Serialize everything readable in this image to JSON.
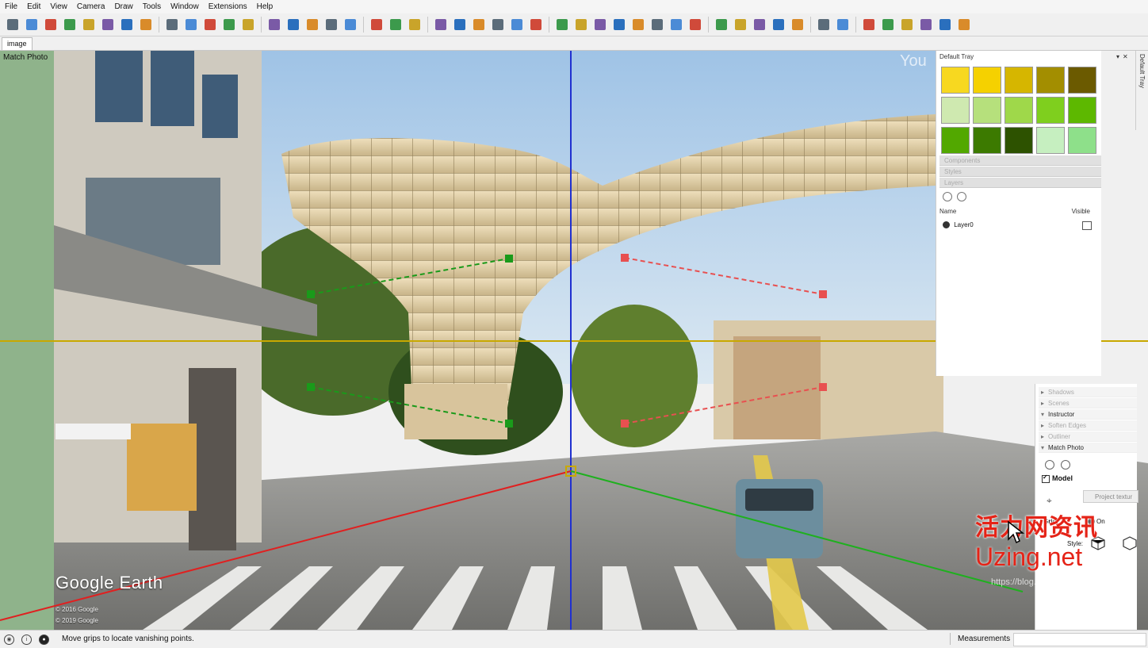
{
  "menu": [
    "File",
    "Edit",
    "View",
    "Camera",
    "Draw",
    "Tools",
    "Window",
    "Extensions",
    "Help"
  ],
  "toolbar_icons": [
    "select-orbit-icon",
    "zoom-icon",
    "paint-icon",
    "eraser-icon",
    "shaded-icon",
    "measure-tape-icon",
    "help-icon",
    "line-icon",
    "component-icon",
    "group-icon",
    "solid-union-icon",
    "solid-sub-icon",
    "arrow-select-icon",
    "section-plane-icon",
    "section-display-icon",
    "align-left-icon",
    "align-center-icon",
    "align-right-icon",
    "minus-icon",
    "plus-icon",
    "equal-icon",
    "grid-1-icon",
    "grid-2-icon",
    "grid-3-icon",
    "grid-4-icon",
    "grid-5-icon",
    "grid-6-icon",
    "texture-icon",
    "material-icon",
    "camera-icon",
    "checker-icon",
    "scatter-icon",
    "link-icon",
    "window-icon",
    "window-2-icon",
    "dim-icon",
    "dim-x-icon",
    "panel-icon",
    "pencil-icon",
    "delete-icon",
    "blue-tag-icon",
    "blue-diamond-icon",
    "yellow-diamond-icon",
    "green-diamond-icon",
    "red-diamond-icon",
    "stack-icon",
    "flag-icon",
    "warning-icon"
  ],
  "tab": {
    "label": "image"
  },
  "scene": {
    "label": "Match Photo",
    "google_earth": "Google Earth",
    "copyright1": "© 2016 Google",
    "copyright2": "© 2019 Google",
    "you_text": "You",
    "axis_colors": {
      "red": "#e02020",
      "green": "#1fb01f",
      "blue": "#2030d0",
      "horizon": "#c8a800"
    }
  },
  "tray": {
    "title": "Default Tray",
    "side_label": "Default Tray",
    "swatch_colors": [
      "#f7d820",
      "#f5d100",
      "#d6b600",
      "#a38e00",
      "#6b5a00",
      "#cfe9b0",
      "#b6e07c",
      "#9fd84a",
      "#7fcf1e",
      "#5db800",
      "#52a800",
      "#3c7a00",
      "#2d5200",
      "#c6efc0",
      "#8ee08a"
    ],
    "panels": [
      "Components",
      "Styles",
      "Layers"
    ],
    "layers_header": {
      "name": "Name",
      "visible": "Visible"
    },
    "layer": "Layer0"
  },
  "panel2": {
    "rows": [
      "Shadows",
      "Scenes",
      "Instructor",
      "Soften Edges",
      "Outliner",
      "Match Photo"
    ],
    "model": "Model",
    "project_button": "Project textur",
    "grid_label": "Grid",
    "grid_value": "On",
    "style_label": "Style:"
  },
  "status": {
    "text": "Move grips to locate vanishing points.",
    "measurements": "Measurements"
  },
  "watermark": {
    "cn": "活力网资讯",
    "en": "Uzing.net",
    "blog": "https://blog.csdn.net/uzing"
  }
}
